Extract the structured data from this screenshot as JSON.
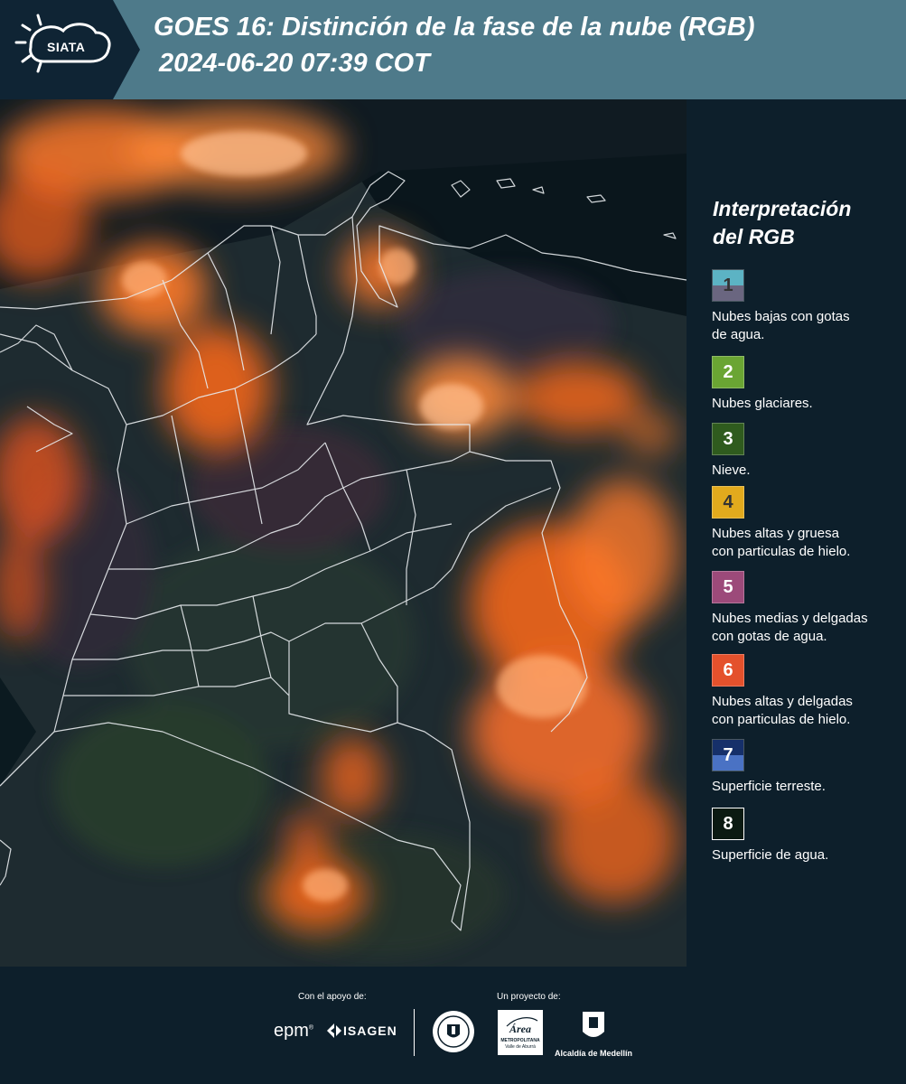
{
  "header": {
    "logo": "SIATA",
    "title_line1": "GOES 16: Distinción de la fase de la nube (RGB)",
    "title_line2": "2024-06-20 07:39 COT"
  },
  "legend": {
    "title_line1": "Interpretación",
    "title_line2": "del RGB",
    "items": [
      {
        "number": "1",
        "label_line1": "Nubes bajas con gotas",
        "label_line2": "de agua.",
        "color_top": "#5cb3c4",
        "color_bottom": "#6a6680",
        "num_color": "#333333"
      },
      {
        "number": "2",
        "label_line1": "Nubes glaciares.",
        "label_line2": "",
        "color_top": "#6aa533",
        "color_bottom": "#6aa533",
        "num_color": "#ffffff"
      },
      {
        "number": "3",
        "label_line1": "Nieve.",
        "label_line2": "",
        "color_top": "#2f5b1e",
        "color_bottom": "#2f5b1e",
        "num_color": "#ffffff"
      },
      {
        "number": "4",
        "label_line1": "Nubes altas y gruesa",
        "label_line2": "con particulas de hielo.",
        "color_top": "#e2aa1d",
        "color_bottom": "#e2aa1d",
        "num_color": "#333333"
      },
      {
        "number": "5",
        "label_line1": "Nubes medias y delgadas",
        "label_line2": "con gotas de agua.",
        "color_top": "#9c4a7a",
        "color_bottom": "#9c4a7a",
        "num_color": "#ffffff"
      },
      {
        "number": "6",
        "label_line1": "Nubes altas y delgadas",
        "label_line2": "con particulas de hielo.",
        "color_top": "#e4512c",
        "color_bottom": "#e4512c",
        "num_color": "#ffffff"
      },
      {
        "number": "7",
        "label_line1": "Superficie terreste.",
        "label_line2": "",
        "color_top": "#16306a",
        "color_bottom": "#4a72c4",
        "num_color": "#ffffff"
      },
      {
        "number": "8",
        "label_line1": "Superficie de agua.",
        "label_line2": "",
        "color_top": "#0b1a12",
        "color_bottom": "#0b1a12",
        "num_color": "#ffffff"
      }
    ]
  },
  "footer": {
    "support_caption": "Con el apoyo de:",
    "project_caption": "Un proyecto de:",
    "epm": "epm",
    "isagen": "ISAGEN",
    "area": "Área",
    "area_sub1": "METROPOLITANA",
    "area_sub2": "Valle de Aburrá",
    "alcaldia": "Alcaldía de Medellín"
  },
  "colors": {
    "header_bg": "#4e7a8a",
    "logo_bg": "#0f2434",
    "panel_bg": "#0d1f2b",
    "cloud_orange": "#ff6a1a",
    "land_dark": "#1d2c30"
  }
}
